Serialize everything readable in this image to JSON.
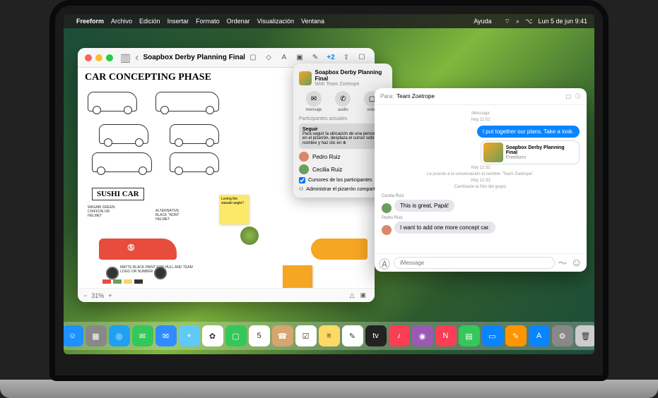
{
  "menubar": {
    "app": "Freeform",
    "items": [
      "Archivo",
      "Edición",
      "Insertar",
      "Formato",
      "Ordenar",
      "Visualización",
      "Ventana"
    ],
    "help": "Ayuda",
    "datetime": "Lun 5 de jun 9:41"
  },
  "freeform": {
    "title": "Soapbox Derby Planning Final",
    "canvas_title": "CAR CONCEPTING PHASE",
    "sushi_label": "SUSHI CAR",
    "annot1": "WASABI GREEN CHIFFON OR HELMET",
    "annot2": "ALTERNATIVE BLACK \"NORI\" HELMET",
    "annot3": "MATTE BLACK PAINT FOR HULL AND TEAM LOGO OR NUMBER",
    "sticky1": "Loving the wasabi angle!!",
    "sticky2": "",
    "zoom": "31%",
    "share_count": "+2"
  },
  "popover": {
    "title": "Soapbox Derby Planning Final",
    "subtitle": "With Team Zoetrope",
    "actions": {
      "msg": "mensaje",
      "audio": "audio",
      "video": "video"
    },
    "participants_header": "Participantes actuales",
    "follow_title": "Seguir",
    "follow_body": "Para seguir la ubicación de una persona en el pizarrón, desplaza el cursor sobre su nombre y haz clic en ⊕",
    "p1": "Pedro Ruiz",
    "p2": "Cecilia Ruiz",
    "cursors": "Cursores de los participantes",
    "manage": "Administrar el pizarrón compartido"
  },
  "messages": {
    "to_label": "Para:",
    "to_value": "Team Zoetrope",
    "meta1_a": "iMessage",
    "meta1_b": "Hoy 11:52",
    "msg_out1": "I put together our plans. Take a look.",
    "attach_title": "Soapbox Derby Planning Final",
    "attach_sub": "Freeform",
    "meta2_a": "Hoy 12:32",
    "meta2_b": "Le pusiste a la conversación el nombre \"Team Zoetrope\".",
    "meta3_a": "Hoy 12:33",
    "meta3_b": "Cambiaste la foto del grupo.",
    "sender1": "Cecilia Ruiz",
    "msg_in1": "This is great, Papá!",
    "sender2": "Pedro Ruiz",
    "msg_in2": "I want to add one more concept car.",
    "placeholder": "iMessage"
  },
  "dock": {
    "items": [
      {
        "name": "finder",
        "color": "#1e90ff",
        "glyph": "☺"
      },
      {
        "name": "launchpad",
        "color": "#888",
        "glyph": "▦"
      },
      {
        "name": "safari",
        "color": "#1ea1f1",
        "glyph": "◎"
      },
      {
        "name": "messages",
        "color": "#34c759",
        "glyph": "✉"
      },
      {
        "name": "mail",
        "color": "#2f8cff",
        "glyph": "✉"
      },
      {
        "name": "maps",
        "color": "#5fc9f8",
        "glyph": "⌖"
      },
      {
        "name": "photos",
        "color": "#fff",
        "glyph": "✿"
      },
      {
        "name": "facetime",
        "color": "#34c759",
        "glyph": "▢"
      },
      {
        "name": "calendar",
        "color": "#fff",
        "glyph": "5"
      },
      {
        "name": "contacts",
        "color": "#d7a56f",
        "glyph": "☎"
      },
      {
        "name": "reminders",
        "color": "#fff",
        "glyph": "☑"
      },
      {
        "name": "notes",
        "color": "#ffd966",
        "glyph": "≡"
      },
      {
        "name": "freeform",
        "color": "#fff",
        "glyph": "✎"
      },
      {
        "name": "tv",
        "color": "#222",
        "glyph": "tv"
      },
      {
        "name": "music",
        "color": "#fa3e53",
        "glyph": "♪"
      },
      {
        "name": "podcasts",
        "color": "#9b59b6",
        "glyph": "◉"
      },
      {
        "name": "news",
        "color": "#fa3e53",
        "glyph": "N"
      },
      {
        "name": "numbers",
        "color": "#34c759",
        "glyph": "▤"
      },
      {
        "name": "keynote",
        "color": "#0a84ff",
        "glyph": "▭"
      },
      {
        "name": "pages",
        "color": "#ff9500",
        "glyph": "✎"
      },
      {
        "name": "appstore",
        "color": "#0a84ff",
        "glyph": "A"
      },
      {
        "name": "settings",
        "color": "#888",
        "glyph": "⚙"
      },
      {
        "name": "trash",
        "color": "#ccc",
        "glyph": "🗑"
      }
    ]
  }
}
